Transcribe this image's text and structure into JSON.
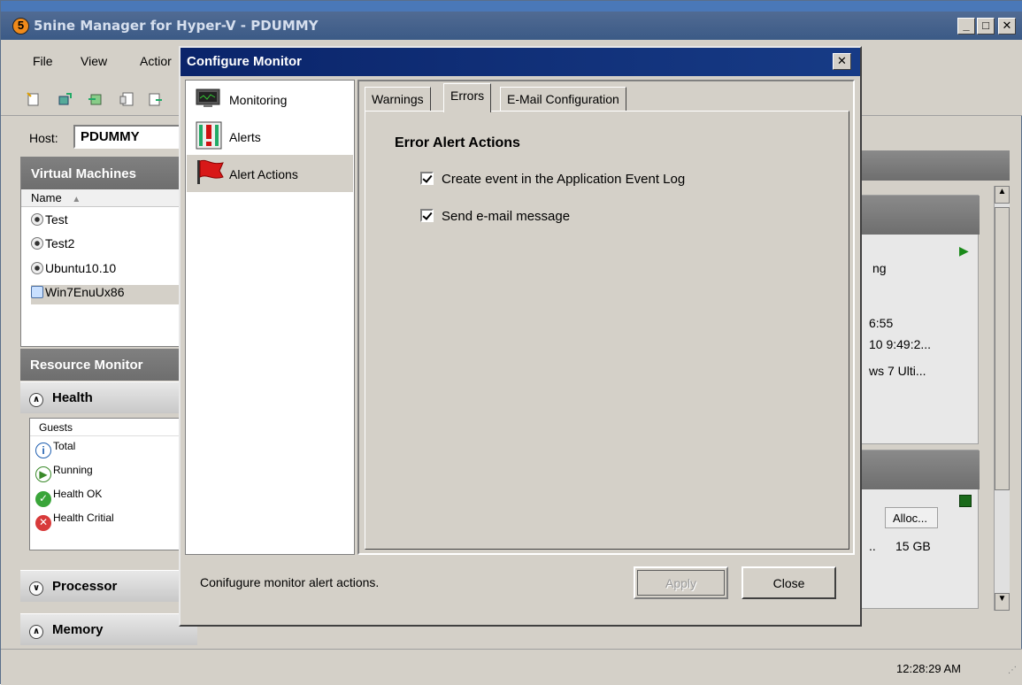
{
  "window": {
    "title": "5nine Manager for Hyper-V - PDUMMY",
    "logo_text": "5",
    "min_label": "_",
    "max_label": "□",
    "close_label": "✕"
  },
  "menu": [
    "File",
    "View",
    "Actior"
  ],
  "host": {
    "label": "Host:",
    "value": "PDUMMY"
  },
  "vm_panel": {
    "title": "Virtual Machines",
    "column": "Name",
    "rows": [
      "Test",
      "Test2",
      "Ubuntu10.10",
      "Win7EnuUx86"
    ]
  },
  "resource_panel": {
    "title": "Resource Monitor",
    "health": "Health",
    "guests_header": "Guests",
    "guests": [
      "Total",
      "Running",
      "Health OK",
      "Health Critial"
    ],
    "processor": "Processor",
    "memory": "Memory"
  },
  "background_fragments": {
    "state": "ng",
    "time1": "6:55",
    "date": "10 9:49:2...",
    "os": "ws 7 Ulti...",
    "col_alloc": "Alloc...",
    "alloc_dots": "..",
    "alloc_value": "15 GB"
  },
  "dialog": {
    "title": "Configure Monitor",
    "close_label": "✕",
    "nav": [
      {
        "label": "Monitoring",
        "icon": "monitor-icon"
      },
      {
        "label": "Alerts",
        "icon": "alert-exclamation-icon"
      },
      {
        "label": "Alert Actions",
        "icon": "red-flag-icon"
      }
    ],
    "tabs": [
      "Warnings",
      "Errors",
      "E-Mail Configuration"
    ],
    "active_tab": "Errors",
    "panel_heading": "Error Alert Actions",
    "options": [
      {
        "label": "Create event in the Application Event Log",
        "checked": true
      },
      {
        "label": "Send e-mail message",
        "checked": true
      }
    ],
    "status_text": "Conifugure monitor alert actions.",
    "apply_label": "Apply",
    "close_button_label": "Close"
  },
  "status_bar": {
    "clock": "12:28:29 AM"
  }
}
